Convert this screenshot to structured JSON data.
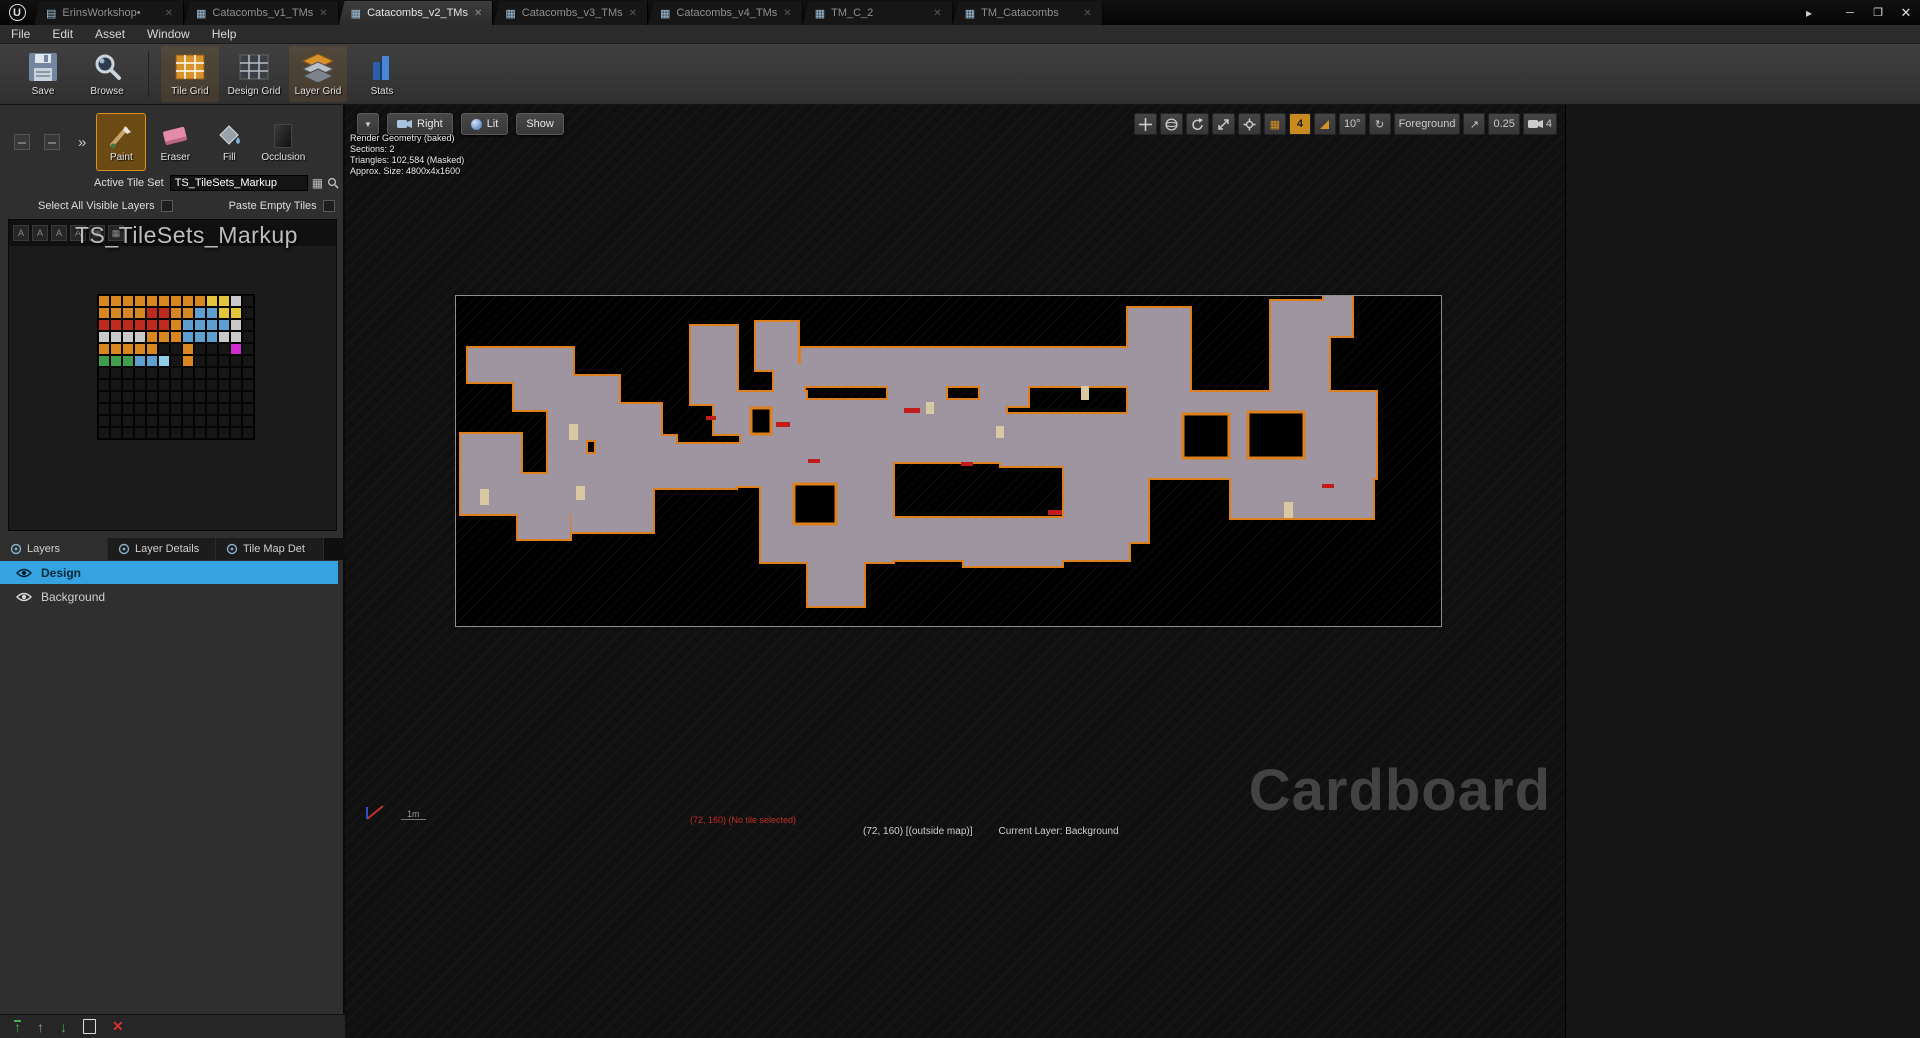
{
  "tab_bar": {
    "tabs": [
      {
        "label": "ErinsWorkshop•"
      },
      {
        "label": "Catacombs_v1_TMs"
      },
      {
        "label": "Catacombs_v2_TMs"
      },
      {
        "label": "Catacombs_v3_TMs"
      },
      {
        "label": "Catacombs_v4_TMs"
      },
      {
        "label": "TM_C_2"
      },
      {
        "label": "TM_Catacombs"
      }
    ]
  },
  "menu_bar": {
    "items": [
      "File",
      "Edit",
      "Asset",
      "Window",
      "Help"
    ]
  },
  "toolbar": {
    "save": "Save",
    "browse": "Browse",
    "tile_grid": "Tile Grid",
    "design_grid": "Design Grid",
    "layer_grid": "Layer Grid",
    "stats": "Stats"
  },
  "tools": {
    "paint": "Paint",
    "eraser": "Eraser",
    "fill": "Fill",
    "occlusion": "Occlusion"
  },
  "tile_set": {
    "label": "Active Tile Set",
    "value": "TS_TileSets_Markup"
  },
  "options": {
    "select_all_visible_layers": "Select All Visible Layers",
    "paste_empty_tiles": "Paste Empty Tiles"
  },
  "tileset_viewer": {
    "title": "TS_TileSets_Markup"
  },
  "palette": {
    "color_map": {
      "o": "#d8861f",
      "r": "#bf2a1f",
      "b": "#5f9fd0",
      "y": "#e3c43b",
      "w": "#c9c9c9",
      "g": "#3f9e4e",
      "m": "#cf2ccf",
      "t": "#8fd0e8",
      "d": "#161616"
    },
    "rows": [
      [
        "o",
        "o",
        "o",
        "o",
        "o",
        "o",
        "o",
        "o",
        "o",
        "y",
        "y",
        "w",
        "d"
      ],
      [
        "o",
        "o",
        "o",
        "o",
        "r",
        "r",
        "o",
        "o",
        "b",
        "b",
        "y",
        "y",
        "d"
      ],
      [
        "r",
        "r",
        "r",
        "r",
        "r",
        "r",
        "o",
        "b",
        "b",
        "b",
        "b",
        "w",
        "d"
      ],
      [
        "w",
        "w",
        "w",
        "w",
        "o",
        "o",
        "o",
        "b",
        "b",
        "b",
        "w",
        "w",
        "d"
      ],
      [
        "o",
        "o",
        "o",
        "o",
        "o",
        "d",
        "d",
        "o",
        "d",
        "d",
        "d",
        "m",
        "d"
      ],
      [
        "g",
        "g",
        "g",
        "b",
        "b",
        "t",
        "d",
        "o",
        "d",
        "d",
        "d",
        "d",
        "d"
      ],
      [
        "d",
        "d",
        "d",
        "d",
        "d",
        "d",
        "d",
        "d",
        "d",
        "d",
        "d",
        "d",
        "d"
      ],
      [
        "d",
        "d",
        "d",
        "d",
        "d",
        "d",
        "d",
        "d",
        "d",
        "d",
        "d",
        "d",
        "d"
      ],
      [
        "d",
        "d",
        "d",
        "d",
        "d",
        "d",
        "d",
        "d",
        "d",
        "d",
        "d",
        "d",
        "d"
      ],
      [
        "d",
        "d",
        "d",
        "d",
        "d",
        "d",
        "d",
        "d",
        "d",
        "d",
        "d",
        "d",
        "d"
      ],
      [
        "d",
        "d",
        "d",
        "d",
        "d",
        "d",
        "d",
        "d",
        "d",
        "d",
        "d",
        "d",
        "d"
      ],
      [
        "d",
        "d",
        "d",
        "d",
        "d",
        "d",
        "d",
        "d",
        "d",
        "d",
        "d",
        "d",
        "d"
      ]
    ]
  },
  "layers_panel": {
    "tabs": [
      {
        "label": "Layers"
      },
      {
        "label": "Layer Details"
      },
      {
        "label": "Tile Map Det"
      }
    ],
    "layers": [
      {
        "label": "Design"
      },
      {
        "label": "Background"
      }
    ]
  },
  "viewport": {
    "view_button": "Right",
    "lit_button": "Lit",
    "show_button": "Show",
    "stats": [
      "Render Geometry (baked)",
      "Sections: 2",
      "Triangles: 102,584 (Masked)",
      "Approx. Size: 4800x4x1600"
    ],
    "snap_value": "4",
    "angle_value": "10°",
    "foreground_button": "Foreground",
    "camera_scale": "0.25",
    "camera_speed": "4",
    "scale_label": "1m",
    "status_warning": "(72, 160) (No tile selected)",
    "status_position": "(72, 160) [(outside map)]",
    "status_layer": "Current Layer: Background",
    "watermark": "Cardboard"
  },
  "map": {
    "fill": "#9e95a1",
    "stroke": "#dd7f1c",
    "hole_fill": "#000000",
    "marker_color": "#c01c1c",
    "ladder_color": "#d9c9a2",
    "blocks": [
      [
        12,
        52,
        105,
        34
      ],
      [
        58,
        80,
        105,
        34
      ],
      [
        100,
        108,
        105,
        36
      ],
      [
        140,
        140,
        80,
        40
      ],
      [
        92,
        112,
        38,
        100
      ],
      [
        5,
        138,
        60,
        46
      ],
      [
        5,
        178,
        115,
        40
      ],
      [
        62,
        205,
        52,
        38
      ],
      [
        115,
        158,
        82,
        78
      ],
      [
        150,
        150,
        130,
        42
      ],
      [
        235,
        30,
        46,
        78
      ],
      [
        300,
        26,
        42,
        48
      ],
      [
        258,
        96,
        92,
        42
      ],
      [
        318,
        68,
        30,
        44
      ],
      [
        345,
        52,
        335,
        38
      ],
      [
        432,
        80,
        58,
        32
      ],
      [
        524,
        78,
        48,
        32
      ],
      [
        285,
        104,
        265,
        62
      ],
      [
        545,
        118,
        140,
        52
      ],
      [
        672,
        12,
        62,
        132
      ],
      [
        815,
        5,
        58,
        102
      ],
      [
        672,
        96,
        248,
        86
      ],
      [
        775,
        178,
        142,
        44
      ],
      [
        305,
        162,
        132,
        104
      ],
      [
        352,
        262,
        56,
        48
      ],
      [
        425,
        222,
        248,
        42
      ],
      [
        508,
        238,
        98,
        32
      ],
      [
        608,
        165,
        84,
        81
      ],
      [
        210,
        148,
        104,
        42
      ],
      [
        868,
        0,
        28,
        40
      ]
    ],
    "holes": [
      [
        727,
        118,
        46,
        44
      ],
      [
        792,
        116,
        56,
        46
      ],
      [
        338,
        188,
        42,
        40
      ],
      [
        295,
        112,
        20,
        26
      ]
    ],
    "markers": [
      [
        320,
        126,
        14,
        5
      ],
      [
        250,
        120,
        10,
        4
      ],
      [
        448,
        112,
        16,
        5
      ],
      [
        352,
        163,
        12,
        4
      ],
      [
        592,
        214,
        14,
        5
      ],
      [
        866,
        188,
        12,
        4
      ],
      [
        505,
        166,
        12,
        4
      ]
    ],
    "ladders": [
      [
        113,
        128,
        9,
        16
      ],
      [
        24,
        193,
        9,
        16
      ],
      [
        120,
        190,
        9,
        14
      ],
      [
        470,
        106,
        8,
        12
      ],
      [
        625,
        90,
        8,
        14
      ],
      [
        828,
        206,
        9,
        16
      ],
      [
        540,
        130,
        8,
        12
      ]
    ]
  }
}
